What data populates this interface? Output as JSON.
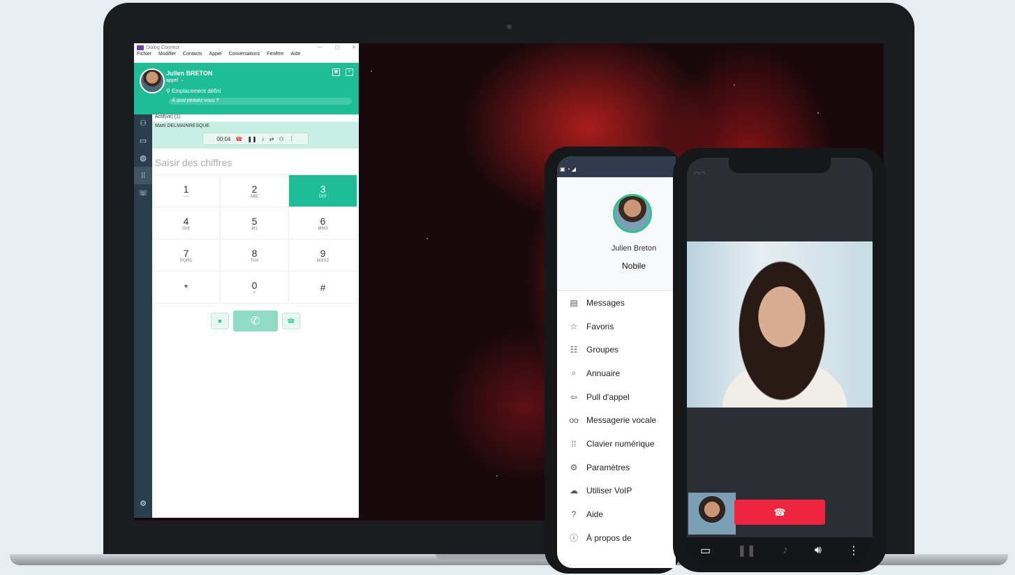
{
  "app": {
    "title": "Dialog Connect",
    "window_controls": [
      "—",
      "▢",
      "✕"
    ],
    "menu": [
      "Fichier",
      "Modifier",
      "Contacts",
      "Appel",
      "Conversations",
      "Fenêtre",
      "Aide"
    ]
  },
  "header": {
    "user_name": "Julien BRETON",
    "status": "appel →",
    "location": "Emplacement défini",
    "mood_placeholder": "À quoi pensez-vous ?"
  },
  "call": {
    "active_label": "Actif(ve) (1)",
    "contact": "Marti DELMAINRESQUE",
    "timer": "00:04"
  },
  "dialer": {
    "placeholder": "Saisir des chiffres",
    "keys": [
      {
        "d": "1",
        "l": "○○"
      },
      {
        "d": "2",
        "l": "ABC"
      },
      {
        "d": "3",
        "l": "DEF"
      },
      {
        "d": "4",
        "l": "GHI"
      },
      {
        "d": "5",
        "l": "JKL"
      },
      {
        "d": "6",
        "l": "MNO"
      },
      {
        "d": "7",
        "l": "PQRS"
      },
      {
        "d": "8",
        "l": "TUV"
      },
      {
        "d": "9",
        "l": "WXYZ"
      },
      {
        "d": "*",
        "l": ""
      },
      {
        "d": "0",
        "l": "+"
      },
      {
        "d": "#",
        "l": ""
      }
    ]
  },
  "phone_menu": {
    "name": "Julien Breton",
    "line": "Nobile",
    "items": [
      {
        "icon": "▤",
        "label": "Messages"
      },
      {
        "icon": "☆",
        "label": "Favoris"
      },
      {
        "icon": "☷",
        "label": "Groupes"
      },
      {
        "icon": "⌕",
        "label": "Annuaire"
      },
      {
        "icon": "⇦",
        "label": "Pull d'appel"
      },
      {
        "icon": "oo",
        "label": "Messagerie vocale"
      },
      {
        "icon": "⁞⁞",
        "label": "Clavier numérique"
      },
      {
        "icon": "⚙",
        "label": "Paramètres"
      },
      {
        "icon": "☁",
        "label": "Utiliser VoIP"
      },
      {
        "icon": "?",
        "label": "Aide"
      },
      {
        "icon": "ⓘ",
        "label": "À propos de"
      }
    ]
  },
  "colors": {
    "brand_green": "#1ebd96",
    "sidebar": "#2a3e4f",
    "hangup": "#f0243f"
  }
}
